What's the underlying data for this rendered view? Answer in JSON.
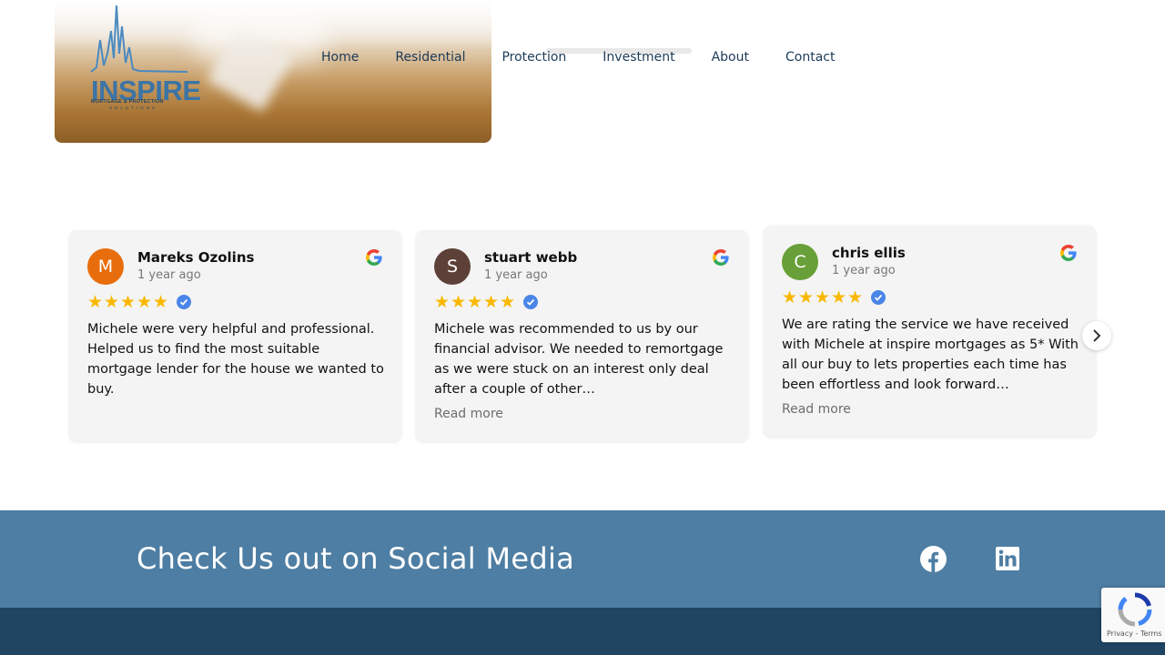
{
  "nav": {
    "items": [
      "Home",
      "Residential",
      "Protection",
      "Investment",
      "About",
      "Contact"
    ]
  },
  "logo": {
    "name": "INSPIRE",
    "tagline": "MORTGAGE & PROTECTION",
    "tagline2": "SOLUTIONS"
  },
  "reviews": [
    {
      "initial": "M",
      "avatar_color": "#e86d0c",
      "name": "Mareks Ozolins",
      "date": "1 year ago",
      "text": "Michele were very helpful and professional. Helped us to find the most suitable mortgage lender for the house we wanted to buy.",
      "more": ""
    },
    {
      "initial": "S",
      "avatar_color": "#5d4037",
      "name": "stuart webb",
      "date": "1 year ago",
      "text": "Michele was recommended to us by our financial advisor. We needed to remortgage as we were stuck on an interest only deal after a couple of other…",
      "more": "Read more"
    },
    {
      "initial": "C",
      "avatar_color": "#689f38",
      "name": "chris ellis",
      "date": "1 year ago",
      "text": "We are rating the service we have received with Michele at inspire mortgages as 5* With all our buy to lets properties each time has been effortless and look forward…",
      "more": "Read more"
    }
  ],
  "social": {
    "heading": "Check Us out on Social Media",
    "icons": [
      "facebook-icon",
      "linkedin-icon"
    ]
  },
  "recaptcha": {
    "terms": "Privacy - Terms"
  },
  "colors": {
    "nav_text": "#1d3a57",
    "social_band": "#4e7ea3",
    "footer": "#1f4562",
    "star": "#f9b800"
  }
}
